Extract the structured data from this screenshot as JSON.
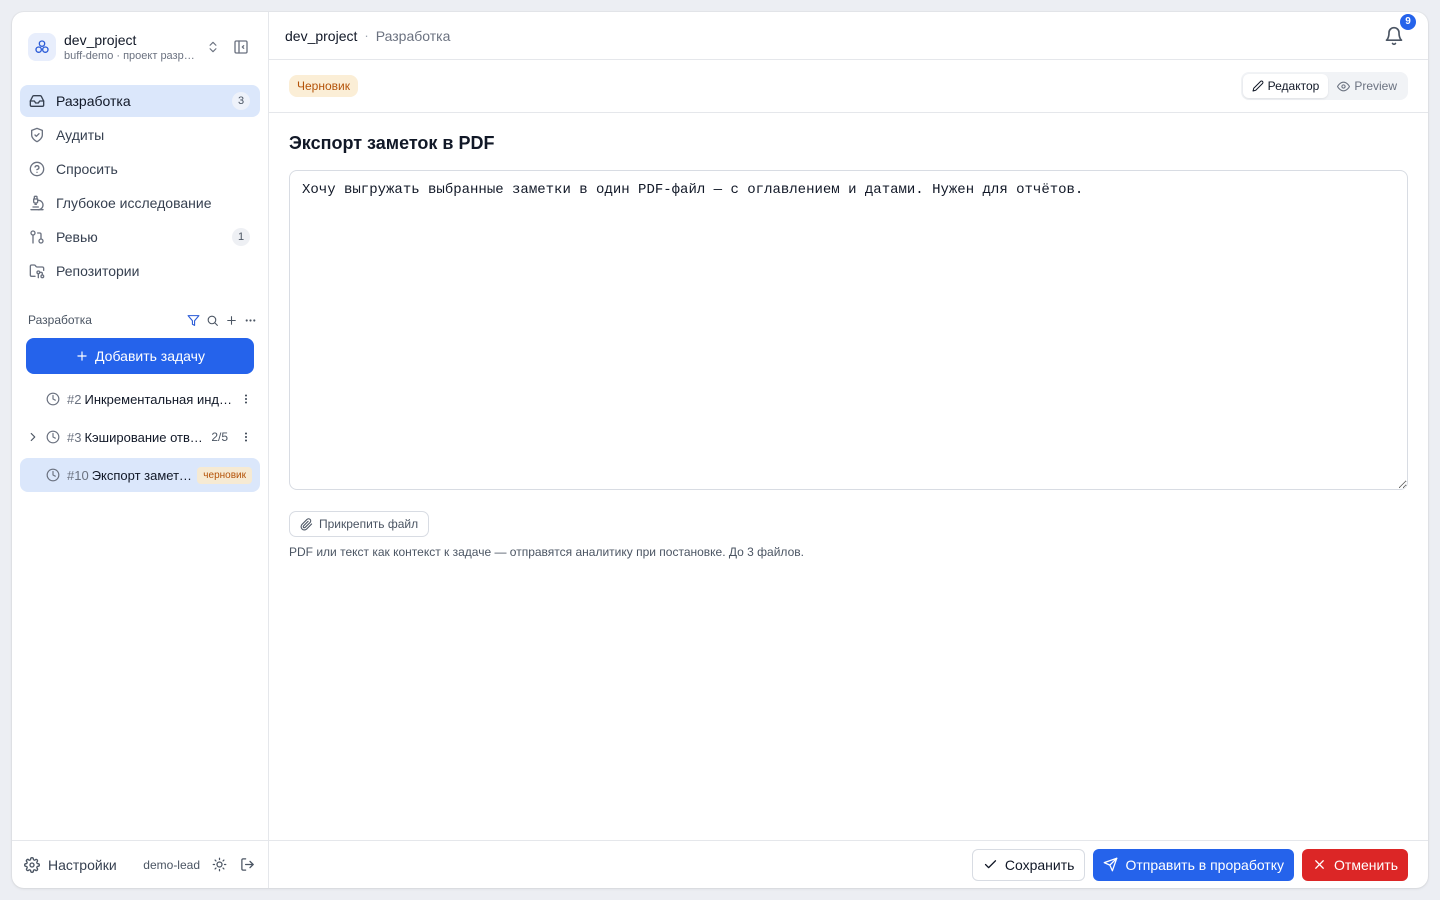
{
  "project": {
    "name": "dev_project",
    "subtitle": "buff-demo · проект разработки"
  },
  "nav": [
    {
      "label": "Разработка",
      "count": "3",
      "icon": "inbox-icon",
      "active": true
    },
    {
      "label": "Аудиты",
      "count": "",
      "icon": "shield-check-icon"
    },
    {
      "label": "Спросить",
      "count": "",
      "icon": "help-circle-icon"
    },
    {
      "label": "Глубокое исследование",
      "count": "",
      "icon": "microscope-icon"
    },
    {
      "label": "Ревью",
      "count": "1",
      "icon": "git-pull-request-icon"
    },
    {
      "label": "Репозитории",
      "count": "",
      "icon": "folder-git-icon"
    }
  ],
  "tasks_section": {
    "title": "Разработка",
    "add_label": "Добавить задачу"
  },
  "tasks": [
    {
      "num": "#2",
      "title": "Инкрементальная индексация",
      "progress": "",
      "badge": ""
    },
    {
      "num": "#3",
      "title": "Кэширование ответов",
      "progress": "2/5",
      "badge": ""
    },
    {
      "num": "#10",
      "title": "Экспорт заметок в PDF",
      "progress": "",
      "badge": "черновик"
    }
  ],
  "footer": {
    "settings_label": "Настройки",
    "user": "demo-lead"
  },
  "breadcrumb": {
    "root": "dev_project",
    "sep": "·",
    "current": "Разработка"
  },
  "notifications": {
    "count": "9"
  },
  "status": {
    "label": "Черновик"
  },
  "modes": {
    "editor": "Редактор",
    "preview": "Preview"
  },
  "task": {
    "title": "Экспорт заметок в PDF",
    "body": "Хочу выгружать выбранные заметки в один PDF-файл — с оглавлением и датами. Нужен для отчётов."
  },
  "attach": {
    "label": "Прикрепить файл",
    "hint": "PDF или текст как контекст к задаче — отправятся аналитику при постановке. До 3 файлов."
  },
  "actions": {
    "save": "Сохранить",
    "send": "Отправить в проработку",
    "cancel": "Отменить"
  },
  "colors": {
    "accent": "#2563eb",
    "active_bg": "#dbe7fb",
    "danger": "#dc2626",
    "draft": "#b45309"
  }
}
